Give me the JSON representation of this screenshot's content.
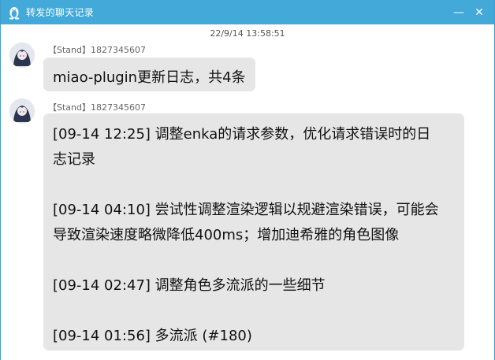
{
  "window": {
    "title": "转发的聊天记录",
    "min_label": "—",
    "close_label": "✕"
  },
  "timestamp": "22/9/14 13:58:51",
  "messages": [
    {
      "sender": "【Stand】1827345607",
      "text": "miao-plugin更新日志，共4条"
    },
    {
      "sender": "【Stand】1827345607",
      "lines": [
        "[09-14 12:25]  调整enka的请求参数，优化请求错误时的日",
        "志记录",
        "[09-14 04:10]  尝试性调整渲染逻辑以规避渲染错误，可能会",
        "导致渲染速度略微降低400ms；增加迪希雅的角色图像",
        "[09-14 02:47]  调整角色多流派的一些细节",
        "[09-14 01:56]  多流派 (#180)"
      ]
    }
  ],
  "colors": {
    "titlebar": "#42a9d8",
    "bubble": "#e6e6e6"
  }
}
